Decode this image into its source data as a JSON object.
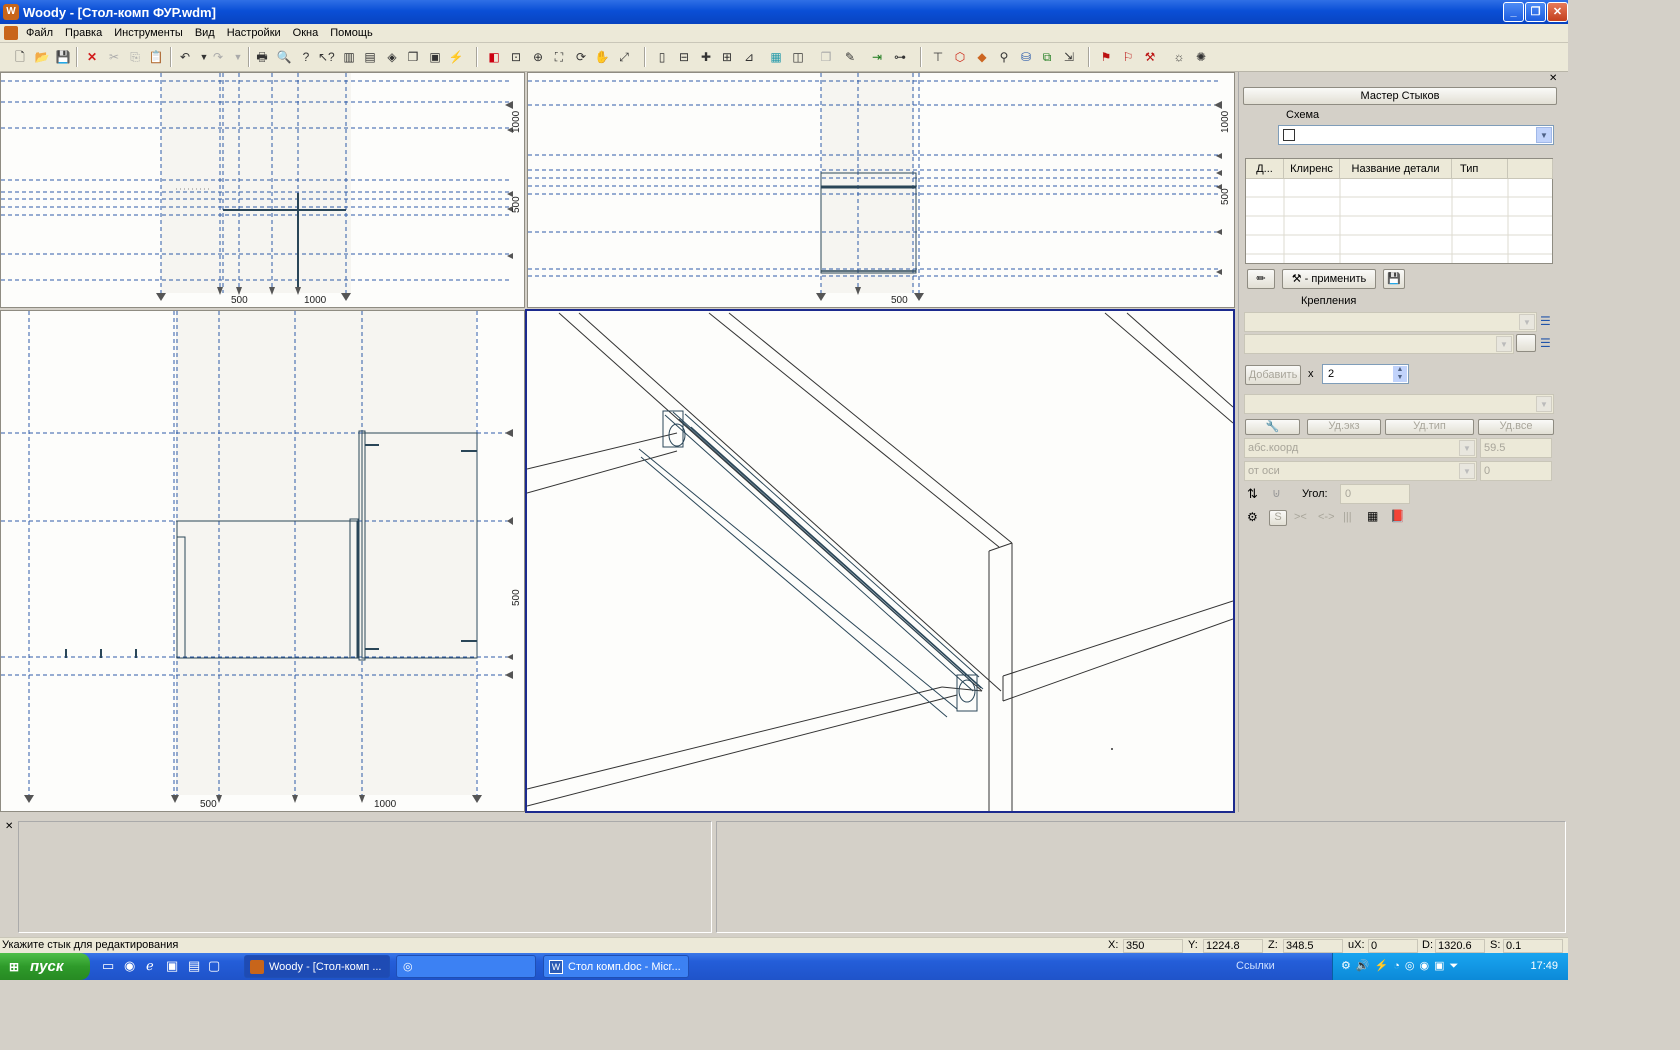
{
  "window": {
    "title": "Woody - [Стол-комп ФУР.wdm]",
    "min_glyph": "_",
    "max_glyph": "❐",
    "close_glyph": "✕"
  },
  "menu": [
    "Файл",
    "Правка",
    "Инструменты",
    "Вид",
    "Настройки",
    "Окна",
    "Помощь"
  ],
  "viewports": {
    "top_left": {
      "ticks_x": [
        "500",
        "1000"
      ],
      "ticks_y": [
        "1000",
        "500"
      ]
    },
    "top_right": {
      "ticks_x": [
        "500"
      ],
      "ticks_y": [
        "1000",
        "500"
      ]
    },
    "bottom_left": {
      "ticks_x": [
        "500",
        "1000"
      ],
      "ticks_y": [
        "500"
      ]
    }
  },
  "panel": {
    "title": "Мастер Стыков",
    "schema_label": "Схема",
    "grid_headers": [
      "Д...",
      "Клиренс",
      "Название детали",
      "Тип"
    ],
    "apply_label": "- применить",
    "fastenings_label": "Крепления",
    "add_label": "Добавить",
    "multiplier_label": "x",
    "multiplier_value": "2",
    "del_instance": "Уд.экз",
    "del_type": "Уд.тип",
    "del_all": "Уд.все",
    "abs_coord": "абс.коорд",
    "abs_value": "59.5",
    "from_axis": "от оси",
    "axis_value": "0",
    "angle_label": "Угол:",
    "angle_value": "0",
    "s_label": "S"
  },
  "status": {
    "hint": "Укажите стык для редактирования",
    "x_label": "X:",
    "x_value": "350",
    "y_label": "Y:",
    "y_value": "1224.8",
    "z_label": "Z:",
    "z_value": "348.5",
    "ux_label": "uX:",
    "ux_value": "0",
    "d_label": "D:",
    "d_value": "1320.6",
    "s_label": "S:",
    "s_value": "0.1"
  },
  "taskbar": {
    "start": "пуск",
    "tasks": [
      "Woody - [Стол-комп ...",
      "Стол комп.doc - Micr..."
    ],
    "links": "Ссылки",
    "clock": "17:49"
  }
}
